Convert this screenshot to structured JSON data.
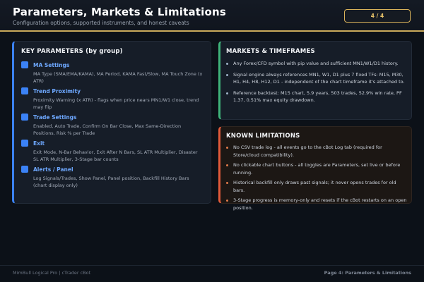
{
  "header": {
    "title": "Parameters, Markets & Limitations",
    "subtitle": "Configuration options, supported instruments, and honest caveats",
    "page_indicator": "4 / 4"
  },
  "parameters": {
    "title": "KEY PARAMETERS (by group)",
    "groups": [
      {
        "title": "MA Settings",
        "desc": "MA Type (SMA/EMA/KAMA), MA Period, KAMA Fast/Slow, MA Touch Zone (x ATR)"
      },
      {
        "title": "Trend Proximity",
        "desc": "Proximity Warning (x ATR) - flags when price nears MN1/W1 close, trend may flip"
      },
      {
        "title": "Trade Settings",
        "desc": "Enabled, Auto Trade, Confirm On Bar Close, Max Same-Direction Positions, Risk % per Trade"
      },
      {
        "title": "Exit",
        "desc": "Exit Mode, N-Bar Behavior, Exit After N Bars, SL ATR Multiplier, Disaster SL ATR Multiplier, 3-Stage bar counts"
      },
      {
        "title": "Alerts / Panel",
        "desc": "Log Signals/Trades, Show Panel, Panel position, Backfill History Bars (chart display only)"
      }
    ]
  },
  "markets": {
    "title": "MARKETS & TIMEFRAMES",
    "items": [
      "Any Forex/CFD symbol with pip value and sufficient MN1/W1/D1 history.",
      "Signal engine always references MN1, W1, D1 plus 7 fixed TFs: M15, M30, H1, H4, H8, H12, D1 - independent of the chart timeframe it's attached to.",
      "Reference backtest: M15 chart, 5.9 years, 503 trades, 52.9% win rate, PF 1.37, 0.51% max equity drawdown."
    ]
  },
  "limitations": {
    "title": "KNOWN LIMITATIONS",
    "items": [
      "No CSV trade log - all events go to the cBot Log tab (required for Store/cloud compatibility).",
      "No clickable chart buttons - all toggles are Parameters, set live or before running.",
      "Historical backfill only draws past signals; it never opens trades for old bars.",
      "3-Stage progress is memory-only and resets if the cBot restarts on an open position."
    ]
  },
  "footer": {
    "left": "MimBull Logical Pro  |  cTrader cBot",
    "right": "Page 4: Parameters & Limitations"
  },
  "colors": {
    "accent_gold": "#c9a95a",
    "params_accent": "#3b82f6",
    "markets_accent": "#3fb37a",
    "limits_accent": "#e05a3a"
  }
}
